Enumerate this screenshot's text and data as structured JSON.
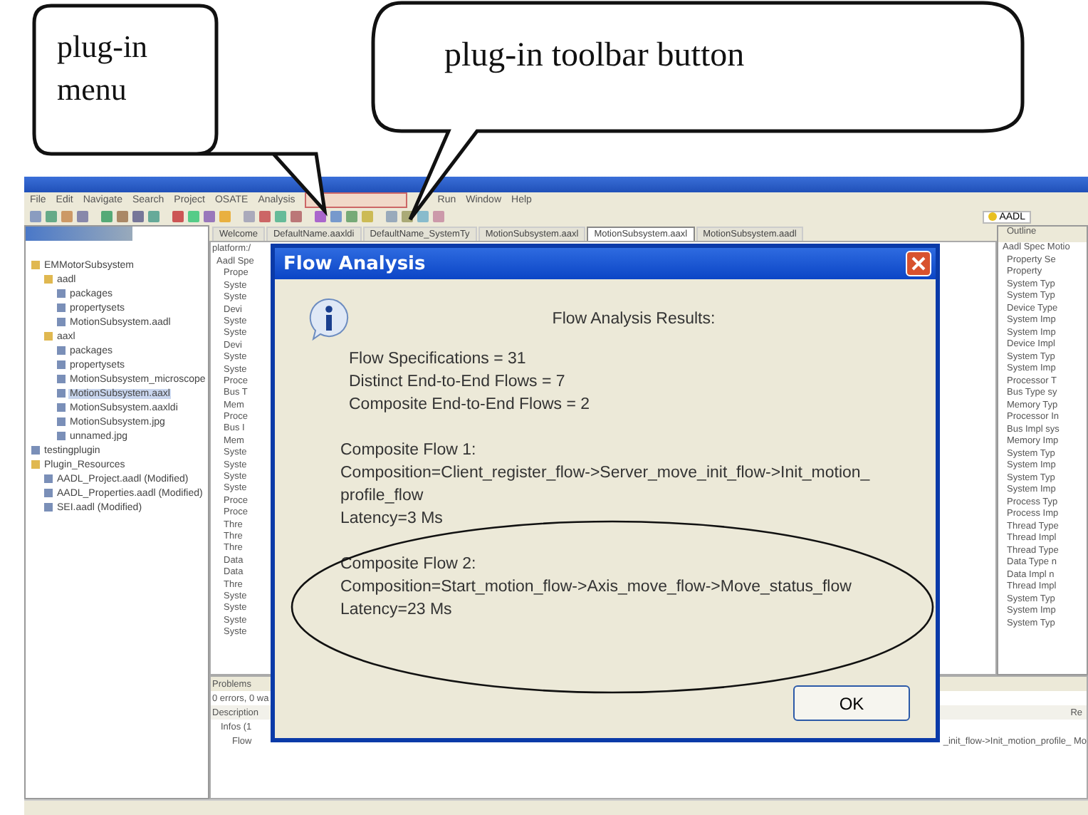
{
  "callouts": [
    {
      "text": "plug-in menu"
    },
    {
      "text": "plug-in toolbar button"
    }
  ],
  "menu_bar": {
    "items": [
      "File",
      "Edit",
      "Navigate",
      "Search",
      "Project",
      "OSATE",
      "Analysis"
    ],
    "plugin_menu_outlined": true,
    "items_after": [
      "Run",
      "Window",
      "Help"
    ]
  },
  "perspective": "AADL",
  "editor_tabs": [
    {
      "label": "Welcome",
      "selected": false
    },
    {
      "label": "DefaultName.aaxldi",
      "selected": false
    },
    {
      "label": "DefaultName_SystemTy",
      "selected": false
    },
    {
      "label": "MotionSubsystem.aaxl",
      "selected": false
    },
    {
      "label": "MotionSubsystem.aaxl",
      "selected": true
    },
    {
      "label": "MotionSubsystem.aadl",
      "selected": false
    }
  ],
  "navigator": {
    "tree": [
      {
        "label": "EMMotorSubsystem",
        "selected": false,
        "children": [
          {
            "label": "aadl",
            "selected": false,
            "children": [
              {
                "label": "packages",
                "selected": false
              },
              {
                "label": "propertysets",
                "selected": false
              },
              {
                "label": "MotionSubsystem.aadl",
                "selected": false
              }
            ]
          },
          {
            "label": "aaxl",
            "selected": false,
            "children": [
              {
                "label": "packages",
                "selected": false
              },
              {
                "label": "propertysets",
                "selected": false
              },
              {
                "label": "MotionSubsystem_microscope",
                "selected": false
              },
              {
                "label": "MotionSubsystem.aaxl",
                "selected": true
              },
              {
                "label": "MotionSubsystem.aaxldi",
                "selected": false
              },
              {
                "label": "MotionSubsystem.jpg",
                "selected": false
              },
              {
                "label": "unnamed.jpg",
                "selected": false
              }
            ]
          }
        ]
      },
      {
        "label": "testingplugin",
        "selected": false
      },
      {
        "label": "Plugin_Resources",
        "selected": false,
        "children": [
          {
            "label": "AADL_Project.aadl (Modified)",
            "selected": false
          },
          {
            "label": "AADL_Properties.aadl (Modified)",
            "selected": false
          },
          {
            "label": "SEI.aadl (Modified)",
            "selected": false
          }
        ]
      }
    ]
  },
  "editor": {
    "path": "platform:/",
    "root": "Aadl Spe",
    "items": [
      "Prope",
      "Syste",
      "Syste",
      "Devi",
      "Syste",
      "Syste",
      "Devi",
      "Syste",
      "Syste",
      "Proce",
      "Bus T",
      "Mem",
      "Proce",
      "Bus I",
      "Mem",
      "Syste",
      "Syste",
      "Syste",
      "Syste",
      "Proce",
      "Proce",
      "Thre",
      "Thre",
      "Thre",
      "Data",
      "Data",
      "Thre",
      "Syste",
      "Syste",
      "Syste",
      "Syste"
    ]
  },
  "outline": {
    "title": "Outline",
    "root": "Aadl Spec Motio",
    "items": [
      "Property Se",
      "Property",
      "System Typ",
      "System Typ",
      "Device Type",
      "System Imp",
      "System Imp",
      "Device Impl",
      "System Typ",
      "System Imp",
      "Processor T",
      "Bus Type sy",
      "Memory Typ",
      "Processor In",
      "Bus Impl sys",
      "Memory Imp",
      "System Typ",
      "System Imp",
      "System Typ",
      "System Imp",
      "Process Typ",
      "Process Imp",
      "Thread Type",
      "Thread Impl",
      "Thread Type",
      "Data Type n",
      "Data Impl n",
      "Thread Impl",
      "System Typ",
      "System Imp",
      "System Typ"
    ]
  },
  "problems": {
    "title": "Problems",
    "summary": "0 errors, 0 wa",
    "column": "Description",
    "right_column": "Re",
    "group": "Infos (1",
    "row": "Flow",
    "row_tail": "_init_flow->Init_motion_profile_ Mo"
  },
  "dialog": {
    "title": "Flow Analysis",
    "heading": "Flow Analysis Results:",
    "stats": [
      "Flow Specifications = 31",
      "Distinct End-to-End Flows = 7",
      "Composite End-to-End Flows = 2"
    ],
    "flows": [
      {
        "title": "Composite Flow 1:",
        "composition": "Composition=Client_register_flow->Server_move_init_flow->Init_motion_profile_flow",
        "latency": "Latency=3 Ms",
        "circled": false
      },
      {
        "title": "Composite Flow 2:",
        "composition": "Composition=Start_motion_flow->Axis_move_flow->Move_status_flow",
        "latency": "Latency=23 Ms",
        "circled": true
      }
    ],
    "button": "OK"
  }
}
